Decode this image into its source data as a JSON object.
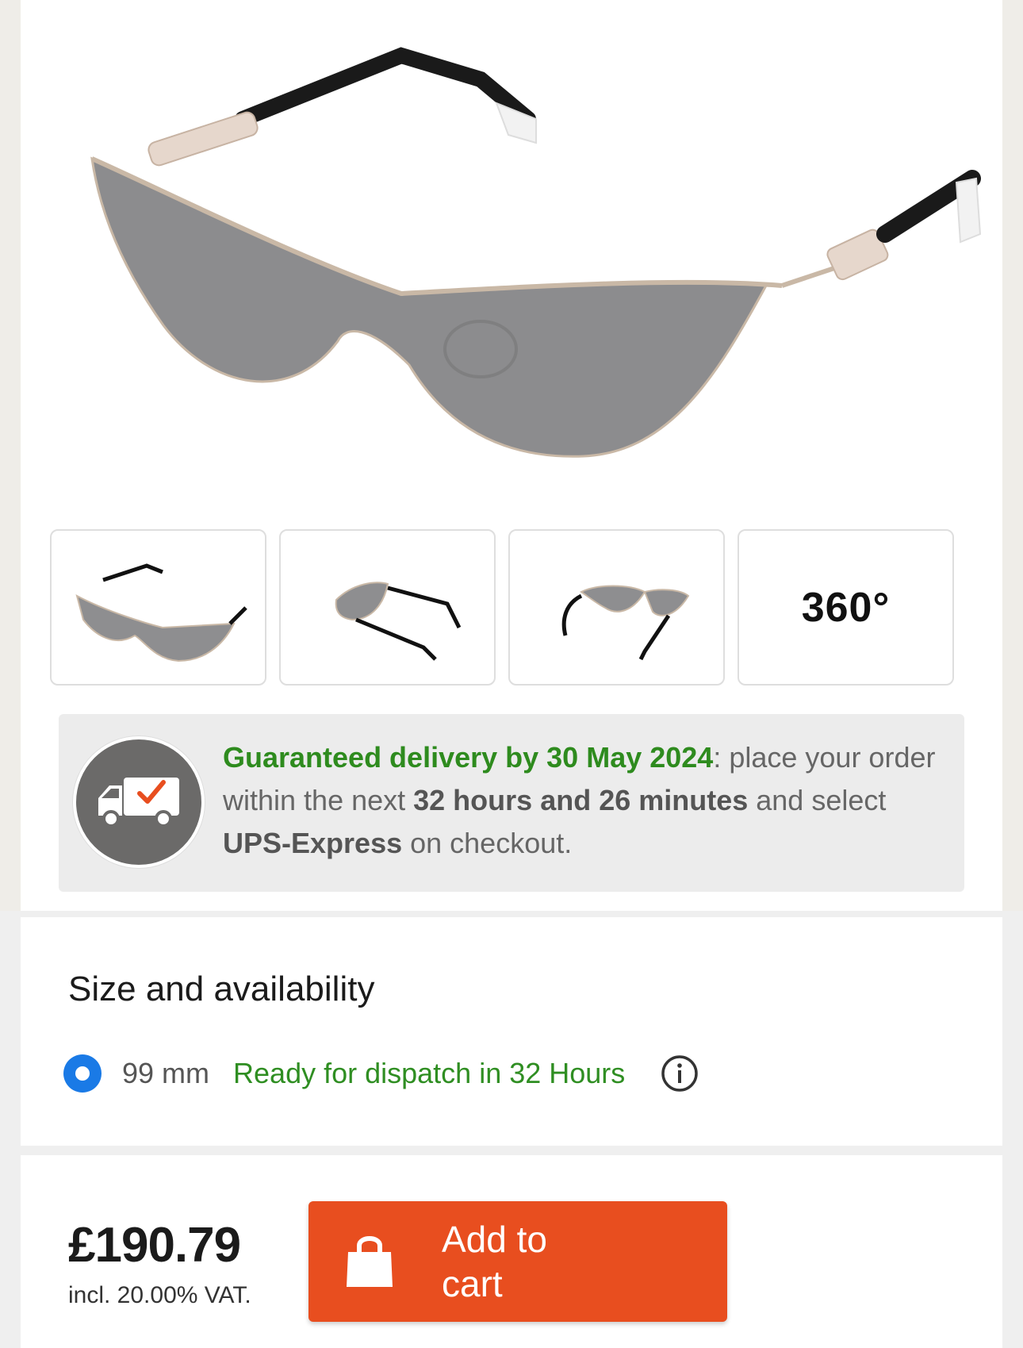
{
  "gallery": {
    "main_image": "product-sunglasses-image",
    "thumbnails": [
      {
        "name": "front-view-thumbnail"
      },
      {
        "name": "side-view-thumbnail"
      },
      {
        "name": "top-view-thumbnail"
      },
      {
        "label": "360°"
      }
    ]
  },
  "delivery": {
    "icon": "delivery-truck-check-icon",
    "headline": "Guaranteed delivery by 30 May 2024",
    "text_1": ": place your order within the next ",
    "time_left": "32 hours and 26 minutes",
    "text_2": " and select ",
    "shipping_method": "UPS-Express",
    "text_3": " on checkout."
  },
  "size": {
    "title": "Size and availability",
    "option_value": "99 mm",
    "availability": "Ready for dispatch in 32 Hours",
    "info_icon": "info-icon"
  },
  "purchase": {
    "price": "£190.79",
    "vat_note": "incl. 20.00% VAT.",
    "add_to_cart_label": "Add to cart",
    "cart_icon": "shopping-bag-icon"
  },
  "colors": {
    "accent_orange": "#e84e1f",
    "availability_green": "#2f8e22",
    "radio_blue": "#1a7ae6"
  }
}
